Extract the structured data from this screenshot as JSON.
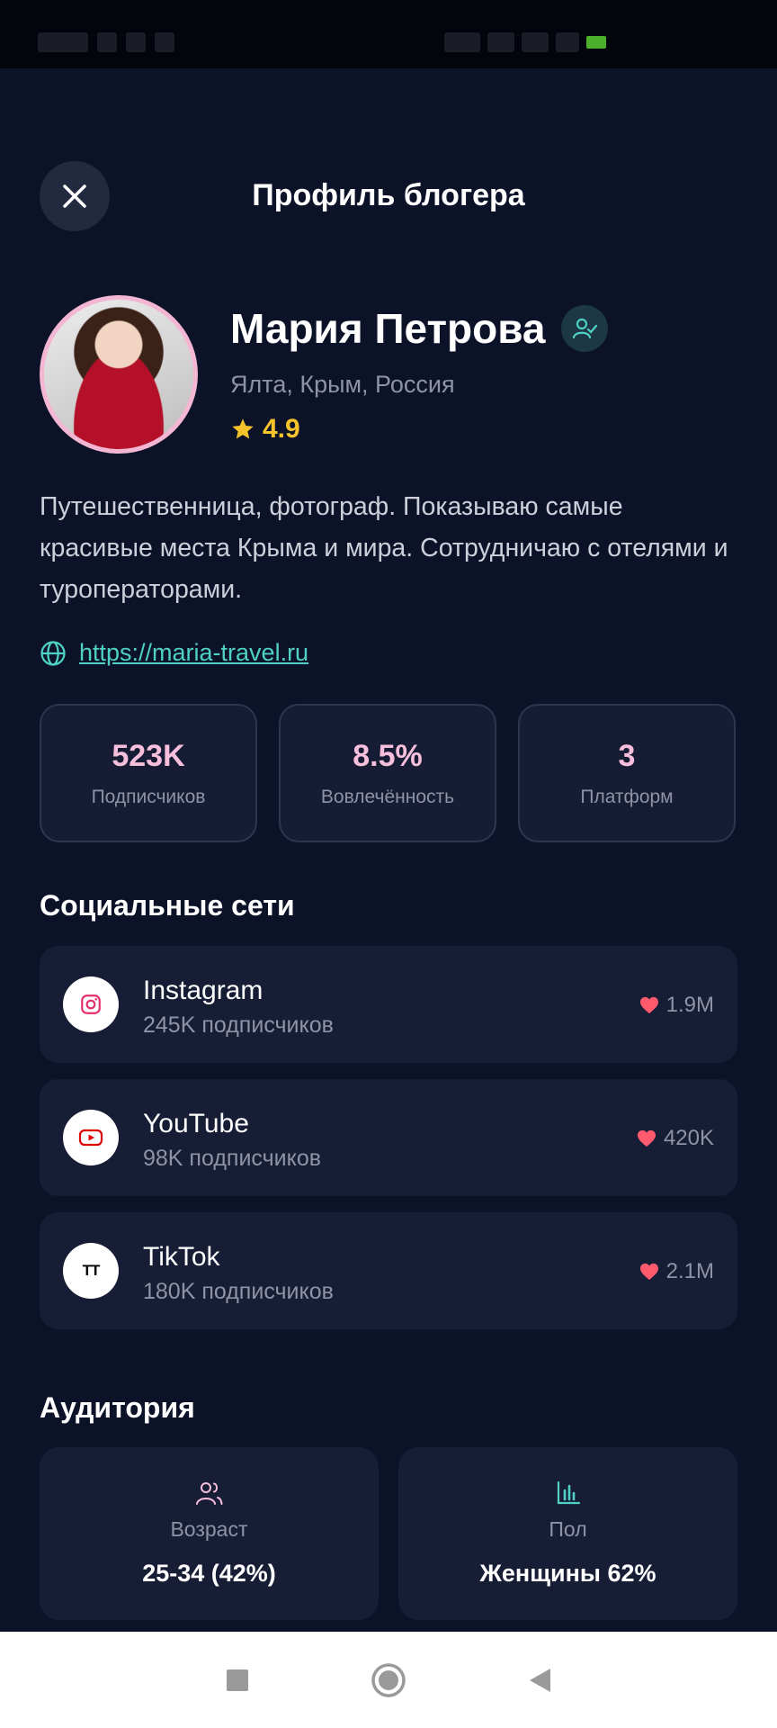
{
  "header": {
    "title": "Профиль блогера",
    "close_icon": "close-icon"
  },
  "profile": {
    "name": "Мария Петрова",
    "location": "Ялта, Крым, Россия",
    "rating": "4.9",
    "bio": "Путешественница, фотограф. Показываю самые красивые места Крыма и мира. Сотрудничаю с отелями и туроператорами.",
    "website": "https://maria-travel.ru"
  },
  "stats": [
    {
      "value": "523K",
      "label": "Подписчиков"
    },
    {
      "value": "8.5%",
      "label": "Вовлечённость"
    },
    {
      "value": "3",
      "label": "Платформ"
    }
  ],
  "social": {
    "title": "Социальные сети",
    "items": [
      {
        "name": "Instagram",
        "subs": "245K подписчиков",
        "likes": "1.9M",
        "icon": "instagram-icon"
      },
      {
        "name": "YouTube",
        "subs": "98K подписчиков",
        "likes": "420K",
        "icon": "youtube-icon"
      },
      {
        "name": "TikTok",
        "subs": "180K подписчиков",
        "likes": "2.1M",
        "icon": "tiktok-icon",
        "glyph": "TT"
      }
    ]
  },
  "audience": {
    "title": "Аудитория",
    "age": {
      "label": "Возраст",
      "value": "25-34 (42%)"
    },
    "gender": {
      "label": "Пол",
      "value": "Женщины 62%"
    }
  },
  "colors": {
    "background": "#0c1228",
    "card": "#171d35",
    "accent_pink": "#f7bfdc",
    "accent_teal": "#4fd1c5",
    "star": "#f6c32a",
    "heart": "#ff5a6e"
  }
}
